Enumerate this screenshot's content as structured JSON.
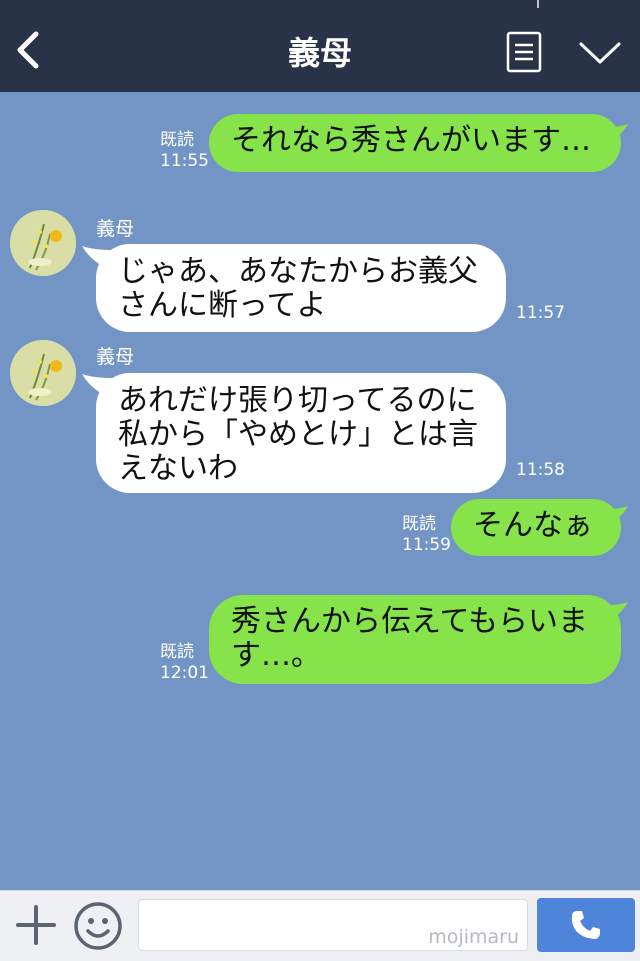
{
  "header": {
    "title": "義母"
  },
  "messages": [
    {
      "text": "それなら秀さんがいます…",
      "read": "既読",
      "time": "11:55"
    },
    {
      "name": "義母",
      "text": "じゃあ、あなたからお義父\nさんに断ってよ",
      "time": "11:57"
    },
    {
      "name": "義母",
      "text": "あれだけ張り切ってるのに\n私から「やめとけ」とは言\nえないわ",
      "time": "11:58"
    },
    {
      "text": "そんなぁ",
      "read": "既読",
      "time": "11:59"
    },
    {
      "text": "秀さんから伝えてもらいま\nす…。",
      "read": "既読",
      "time": "12:01"
    }
  ],
  "footer": {
    "watermark": "mojimaru"
  },
  "colors": {
    "header": "#283347",
    "background": "#7395c6",
    "outgoing": "#86e34a",
    "incoming": "#ffffff",
    "call": "#4e84d9"
  },
  "icons": [
    "back-icon",
    "menu-icon",
    "chevron-down-icon",
    "plus-icon",
    "emoji-icon",
    "phone-icon"
  ]
}
